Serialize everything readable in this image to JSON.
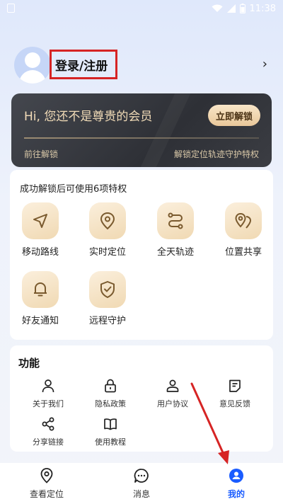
{
  "status_bar": {
    "time": "11:38"
  },
  "profile": {
    "login_label": "登录/注册",
    "arrow": "›"
  },
  "vip": {
    "title": "Hi, 您还不是尊贵的会员",
    "unlock_button": "立即解锁",
    "footer_left": "前往解锁",
    "footer_right": "解锁定位轨迹守护特权"
  },
  "privileges": {
    "title": "成功解锁后可使用6项特权",
    "items": [
      {
        "label": "移动路线",
        "icon": "navigation-arrow-icon"
      },
      {
        "label": "实时定位",
        "icon": "location-pin-icon"
      },
      {
        "label": "全天轨迹",
        "icon": "route-track-icon"
      },
      {
        "label": "位置共享",
        "icon": "shared-location-icon"
      },
      {
        "label": "好友通知",
        "icon": "bell-icon"
      },
      {
        "label": "远程守护",
        "icon": "shield-check-icon"
      }
    ]
  },
  "functions": {
    "title": "功能",
    "items": [
      {
        "label": "关于我们",
        "icon": "person-icon"
      },
      {
        "label": "隐私政策",
        "icon": "lock-icon"
      },
      {
        "label": "用户协议",
        "icon": "user-card-icon"
      },
      {
        "label": "意见反馈",
        "icon": "feedback-icon"
      },
      {
        "label": "分享链接",
        "icon": "share-icon"
      },
      {
        "label": "使用教程",
        "icon": "book-icon"
      }
    ]
  },
  "nav": {
    "items": [
      {
        "label": "查看定位",
        "icon": "location-pin-icon",
        "active": false
      },
      {
        "label": "消息",
        "icon": "message-icon",
        "active": false
      },
      {
        "label": "我的",
        "icon": "profile-icon",
        "active": true
      }
    ]
  },
  "colors": {
    "accent": "#1a5cff",
    "vip_gold": "#f2dcb8",
    "annotation_red": "#d62424"
  }
}
